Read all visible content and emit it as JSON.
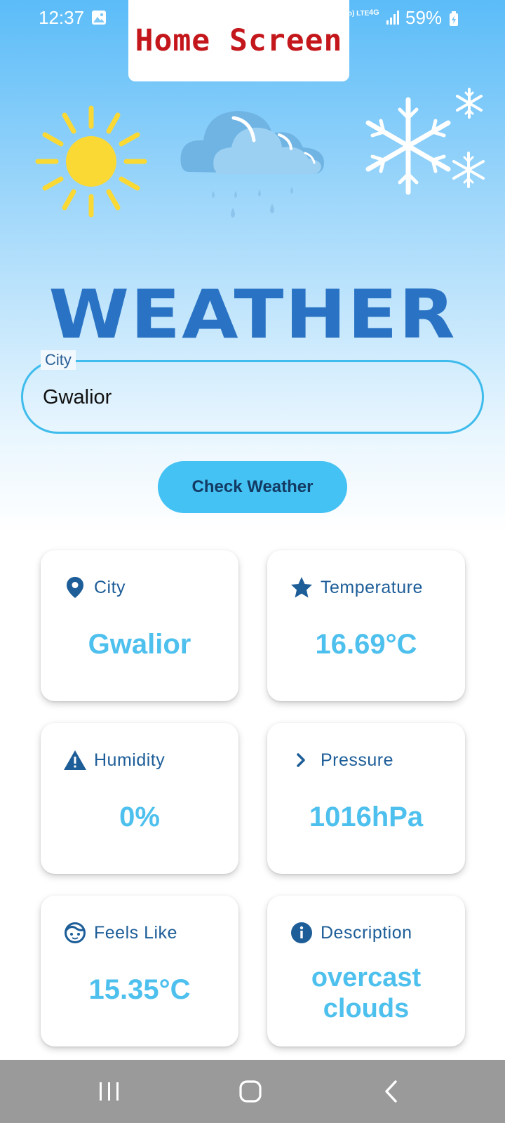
{
  "status_bar": {
    "time": "12:37",
    "network_label": "Vo) LTE",
    "network_type": "4G",
    "battery": "59%"
  },
  "header": {
    "title": "Home Screen"
  },
  "logo_text": "WEATHER",
  "search": {
    "label": "City",
    "value": "Gwalior"
  },
  "check_button_label": "Check Weather",
  "cards": [
    {
      "label": "City",
      "value": "Gwalior",
      "icon": "location-pin-icon"
    },
    {
      "label": "Temperature",
      "value": "16.69°C",
      "icon": "star-icon"
    },
    {
      "label": "Humidity",
      "value": "0%",
      "icon": "warning-icon"
    },
    {
      "label": "Pressure",
      "value": "1016hPa",
      "icon": "chevron-right-icon"
    },
    {
      "label": "Feels Like",
      "value": "15.35°C",
      "icon": "face-icon"
    },
    {
      "label": "Description",
      "value": "overcast clouds",
      "icon": "info-icon"
    }
  ],
  "colors": {
    "accent": "#44c2f3",
    "value_text": "#4ec0ee",
    "label_text": "#1d5d98",
    "title_red": "#c4171c",
    "logo_blue": "#2a73c4"
  }
}
